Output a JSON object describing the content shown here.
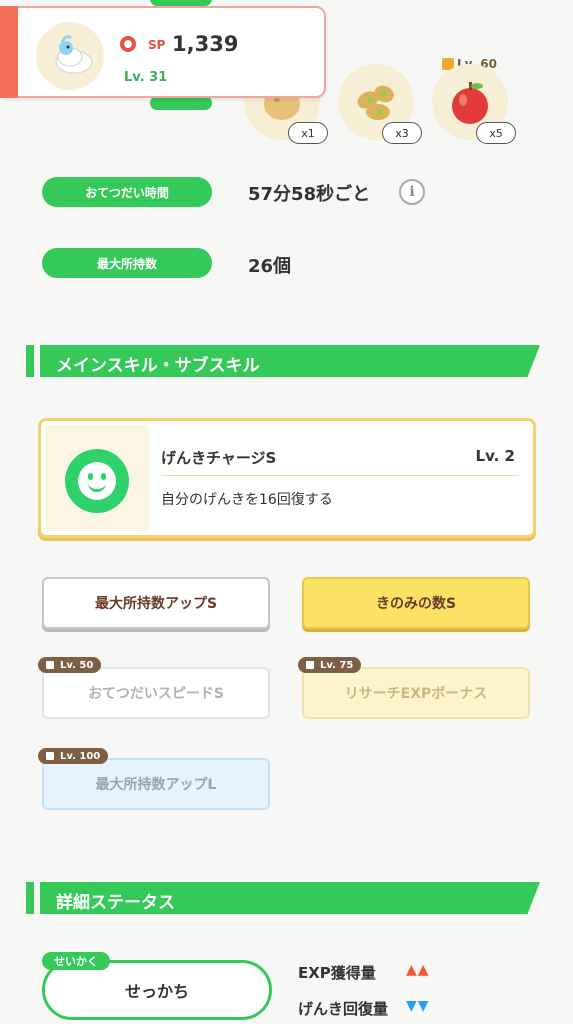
{
  "pokemon": {
    "sp_label": "SP",
    "sp_value": "1,339",
    "level": "Lv. 31"
  },
  "ingredients": [
    {
      "name": "potato",
      "qty": "x1"
    },
    {
      "name": "soybeans",
      "qty": "x3"
    },
    {
      "name": "apple",
      "qty": "x5",
      "lock_level": "Lv. 60"
    }
  ],
  "stats": {
    "help_time_label": "おてつだい時間",
    "help_time_value": "57分58秒ごと",
    "max_carry_label": "最大所持数",
    "max_carry_value": "26個",
    "info_icon": "i"
  },
  "skills_section": {
    "title": "メインスキル・サブスキル"
  },
  "main_skill": {
    "name": "げんきチャージS",
    "level": "Lv. 2",
    "description": "自分のげんきを16回復する"
  },
  "sub_skills": [
    {
      "label": "最大所持数アップS",
      "style": "white",
      "unlocked": true
    },
    {
      "label": "きのみの数S",
      "style": "gold",
      "unlocked": true
    },
    {
      "label": "おてつだいスピードS",
      "style": "white",
      "unlocked": false,
      "lock_level": "Lv. 50"
    },
    {
      "label": "リサーチEXPボーナス",
      "style": "gold",
      "unlocked": false,
      "lock_level": "Lv. 75"
    },
    {
      "label": "最大所持数アップL",
      "style": "blue",
      "unlocked": false,
      "lock_level": "Lv. 100"
    }
  ],
  "detail_section": {
    "title": "詳細ステータス"
  },
  "nature": {
    "tag": "せいかく",
    "value": "せっかち"
  },
  "nature_mods": [
    {
      "label": "EXP獲得量",
      "arrows": "▲▲",
      "color": "#f05a3a"
    },
    {
      "label": "げんき回復量",
      "arrows": "▼▼",
      "color": "#2e9bf0"
    }
  ]
}
